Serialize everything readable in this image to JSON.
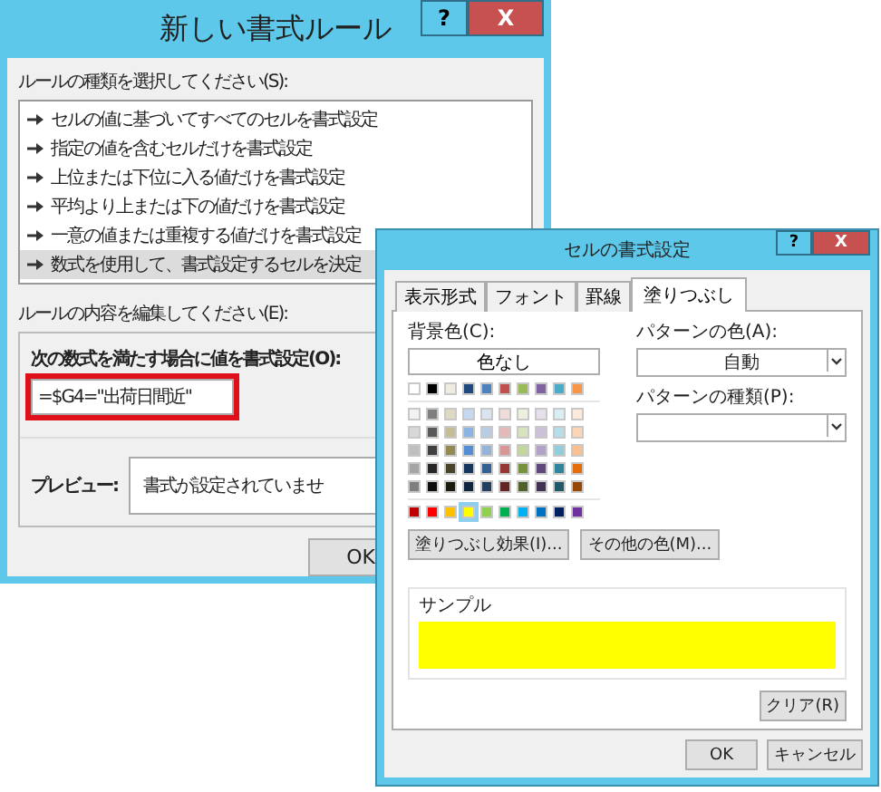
{
  "rule_dialog": {
    "title": "新しい書式ルール",
    "help_button": "?",
    "close_button": "X",
    "rule_type_label": "ルールの種類を選択してください(S):",
    "rule_types": [
      {
        "label": "セルの値に基づいてすべてのセルを書式設定",
        "selected": false
      },
      {
        "label": "指定の値を含むセルだけを書式設定",
        "selected": false
      },
      {
        "label": "上位または下位に入る値だけを書式設定",
        "selected": false
      },
      {
        "label": "平均より上または下の値だけを書式設定",
        "selected": false
      },
      {
        "label": "一意の値または重複する値だけを書式設定",
        "selected": false
      },
      {
        "label": "数式を使用して、書式設定するセルを決定",
        "selected": true
      }
    ],
    "edit_label": "ルールの内容を編集してください(E):",
    "formula_label": "次の数式を満たす場合に値を書式設定(O):",
    "formula": {
      "value": "=$G4=\"出荷日間近\"",
      "highlighted": true
    },
    "preview_label": "プレビュー:",
    "preview_text": "書式が設定されていませ",
    "ok_button": "OK"
  },
  "format_dialog": {
    "title": "セルの書式設定",
    "help_button": "?",
    "close_button": "X",
    "tabs": [
      {
        "label": "表示形式",
        "selected": false
      },
      {
        "label": "フォント",
        "selected": false
      },
      {
        "label": "罫線",
        "selected": false
      },
      {
        "label": "塗りつぶし",
        "selected": true
      }
    ],
    "background_label": "背景色(C):",
    "no_color_button": "色なし",
    "theme_colors": [
      {
        "swatches": [
          {
            "color": "#ffffff",
            "selected": false
          },
          {
            "color": "#000000",
            "selected": false
          },
          {
            "color": "#eeece1",
            "selected": false
          },
          {
            "color": "#1f497d",
            "selected": false
          },
          {
            "color": "#4f81bd",
            "selected": false
          },
          {
            "color": "#c0504d",
            "selected": false
          },
          {
            "color": "#9bbb59",
            "selected": false
          },
          {
            "color": "#8064a2",
            "selected": false
          },
          {
            "color": "#4bacc6",
            "selected": false
          },
          {
            "color": "#f79646",
            "selected": false
          }
        ]
      },
      {
        "swatches": [
          {
            "color": "#f2f2f2",
            "selected": false
          },
          {
            "color": "#7f7f7f",
            "selected": false
          },
          {
            "color": "#ddd9c3",
            "selected": false
          },
          {
            "color": "#c6d9f0",
            "selected": false
          },
          {
            "color": "#dbe5f1",
            "selected": false
          },
          {
            "color": "#f2dcdb",
            "selected": false
          },
          {
            "color": "#ebf1dd",
            "selected": false
          },
          {
            "color": "#e5e0ec",
            "selected": false
          },
          {
            "color": "#dbeef3",
            "selected": false
          },
          {
            "color": "#fdeada",
            "selected": false
          }
        ]
      },
      {
        "swatches": [
          {
            "color": "#d8d8d8",
            "selected": false
          },
          {
            "color": "#595959",
            "selected": false
          },
          {
            "color": "#c4bd97",
            "selected": false
          },
          {
            "color": "#8db3e2",
            "selected": false
          },
          {
            "color": "#b8cce4",
            "selected": false
          },
          {
            "color": "#e5b9b7",
            "selected": false
          },
          {
            "color": "#d7e3bc",
            "selected": false
          },
          {
            "color": "#ccc1d9",
            "selected": false
          },
          {
            "color": "#b7dde8",
            "selected": false
          },
          {
            "color": "#fbd5b5",
            "selected": false
          }
        ]
      },
      {
        "swatches": [
          {
            "color": "#bfbfbf",
            "selected": false
          },
          {
            "color": "#3f3f3f",
            "selected": false
          },
          {
            "color": "#938953",
            "selected": false
          },
          {
            "color": "#548dd4",
            "selected": false
          },
          {
            "color": "#95b3d7",
            "selected": false
          },
          {
            "color": "#d99694",
            "selected": false
          },
          {
            "color": "#c3d69b",
            "selected": false
          },
          {
            "color": "#b2a2c7",
            "selected": false
          },
          {
            "color": "#92cddc",
            "selected": false
          },
          {
            "color": "#fac08f",
            "selected": false
          }
        ]
      },
      {
        "swatches": [
          {
            "color": "#a5a5a5",
            "selected": false
          },
          {
            "color": "#262626",
            "selected": false
          },
          {
            "color": "#494429",
            "selected": false
          },
          {
            "color": "#17365d",
            "selected": false
          },
          {
            "color": "#366092",
            "selected": false
          },
          {
            "color": "#953734",
            "selected": false
          },
          {
            "color": "#76923c",
            "selected": false
          },
          {
            "color": "#5f497a",
            "selected": false
          },
          {
            "color": "#31859b",
            "selected": false
          },
          {
            "color": "#e36c09",
            "selected": false
          }
        ]
      },
      {
        "swatches": [
          {
            "color": "#7f7f7f",
            "selected": false
          },
          {
            "color": "#0c0c0c",
            "selected": false
          },
          {
            "color": "#1d1b10",
            "selected": false
          },
          {
            "color": "#0f243e",
            "selected": false
          },
          {
            "color": "#244061",
            "selected": false
          },
          {
            "color": "#632423",
            "selected": false
          },
          {
            "color": "#4f6128",
            "selected": false
          },
          {
            "color": "#3f3151",
            "selected": false
          },
          {
            "color": "#205867",
            "selected": false
          },
          {
            "color": "#974806",
            "selected": false
          }
        ]
      }
    ],
    "standard_colors": [
      {
        "color": "#c00000",
        "selected": false
      },
      {
        "color": "#ff0000",
        "selected": false
      },
      {
        "color": "#ffc000",
        "selected": false
      },
      {
        "color": "#ffff00",
        "selected": true
      },
      {
        "color": "#92d050",
        "selected": false
      },
      {
        "color": "#00b050",
        "selected": false
      },
      {
        "color": "#00b0f0",
        "selected": false
      },
      {
        "color": "#0070c0",
        "selected": false
      },
      {
        "color": "#002060",
        "selected": false
      },
      {
        "color": "#7030a0",
        "selected": false
      }
    ],
    "effects_button": "塗りつぶし効果(I)...",
    "more_colors_button": "その他の色(M)...",
    "pattern_color_label": "パターンの色(A):",
    "pattern_color_value": "自動",
    "pattern_style_label": "パターンの種類(P):",
    "sample_label": "サンプル",
    "clear_button": "クリア(R)",
    "ok_button": "OK",
    "cancel_button": "キャンセル"
  }
}
